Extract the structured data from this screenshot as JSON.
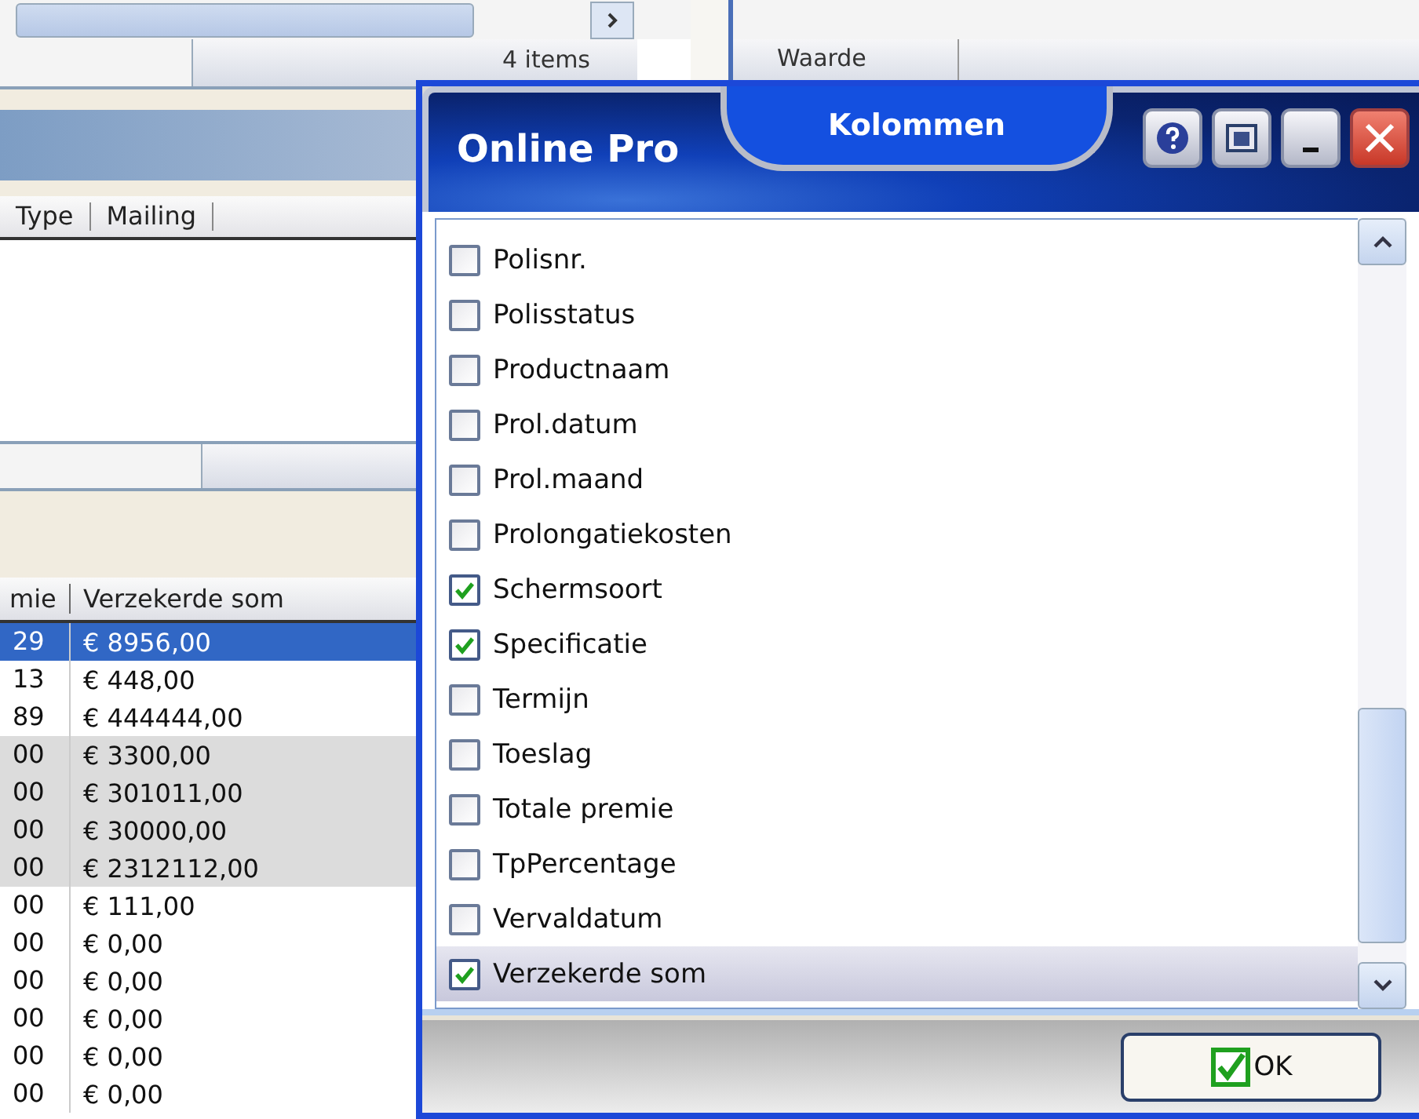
{
  "background": {
    "status_bar": {
      "count": "4 items"
    },
    "list_columns": [
      "Type",
      "Mailing"
    ],
    "table": {
      "columns": [
        "mie",
        "Verzekerde som"
      ],
      "rows": [
        {
          "cells": [
            "29",
            "€ 8956,00"
          ],
          "selected": true,
          "shaded": false
        },
        {
          "cells": [
            "13",
            "€ 448,00"
          ],
          "selected": false,
          "shaded": false
        },
        {
          "cells": [
            "89",
            "€ 444444,00"
          ],
          "selected": false,
          "shaded": false
        },
        {
          "cells": [
            "00",
            "€ 3300,00"
          ],
          "selected": false,
          "shaded": true
        },
        {
          "cells": [
            "00",
            "€ 301011,00"
          ],
          "selected": false,
          "shaded": true
        },
        {
          "cells": [
            "00",
            "€ 30000,00"
          ],
          "selected": false,
          "shaded": true
        },
        {
          "cells": [
            "00",
            "€ 2312112,00"
          ],
          "selected": false,
          "shaded": true
        },
        {
          "cells": [
            "00",
            "€ 111,00"
          ],
          "selected": false,
          "shaded": false
        },
        {
          "cells": [
            "00",
            "€ 0,00"
          ],
          "selected": false,
          "shaded": false
        },
        {
          "cells": [
            "00",
            "€ 0,00"
          ],
          "selected": false,
          "shaded": false
        },
        {
          "cells": [
            "00",
            "€ 0,00"
          ],
          "selected": false,
          "shaded": false
        },
        {
          "cells": [
            "00",
            "€ 0,00"
          ],
          "selected": false,
          "shaded": false
        },
        {
          "cells": [
            "00",
            "€ 0,00"
          ],
          "selected": false,
          "shaded": false
        }
      ]
    },
    "right_pane": {
      "header": "Waarde"
    }
  },
  "dialog": {
    "brand": "Online Pro",
    "title": "Kolommen",
    "items": [
      {
        "label": "Polisnr.",
        "checked": false,
        "selected": false
      },
      {
        "label": "Polisstatus",
        "checked": false,
        "selected": false
      },
      {
        "label": "Productnaam",
        "checked": false,
        "selected": false
      },
      {
        "label": "Prol.datum",
        "checked": false,
        "selected": false
      },
      {
        "label": "Prol.maand",
        "checked": false,
        "selected": false
      },
      {
        "label": "Prolongatiekosten",
        "checked": false,
        "selected": false
      },
      {
        "label": "Schermsoort",
        "checked": true,
        "selected": false
      },
      {
        "label": "Specificatie",
        "checked": true,
        "selected": false
      },
      {
        "label": "Termijn",
        "checked": false,
        "selected": false
      },
      {
        "label": "Toeslag",
        "checked": false,
        "selected": false
      },
      {
        "label": "Totale premie",
        "checked": false,
        "selected": false
      },
      {
        "label": "TpPercentage",
        "checked": false,
        "selected": false
      },
      {
        "label": "Vervaldatum",
        "checked": false,
        "selected": false
      },
      {
        "label": "Verzekerde som",
        "checked": true,
        "selected": true
      }
    ],
    "ok_button": "OK"
  }
}
